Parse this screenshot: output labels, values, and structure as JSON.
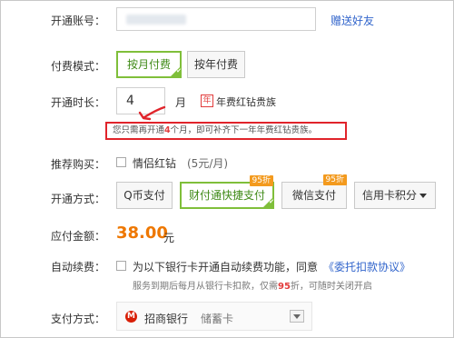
{
  "form": {
    "account": {
      "label": "开通账号：",
      "gift_link": "赠送好友"
    },
    "mode": {
      "label": "付费模式：",
      "options": [
        "按月付费",
        "按年付费"
      ],
      "selected": "按月付费"
    },
    "duration": {
      "label": "开通时长：",
      "value": "4",
      "unit": "月",
      "year_badge": "年",
      "year_text": "年费红钻贵族"
    },
    "notice": {
      "prefix": "您只需再开通",
      "count": "4",
      "suffix": "个月，即可补齐下一年年费红钻贵族。"
    },
    "recommend": {
      "label": "推荐购买：",
      "item": "情侣红钻",
      "price": "(5元/月)"
    },
    "payment": {
      "label": "开通方式：",
      "methods": [
        {
          "name": "Q币支付",
          "tag": ""
        },
        {
          "name": "财付通快捷支付",
          "tag": "95折"
        },
        {
          "name": "微信支付",
          "tag": "95折"
        },
        {
          "name": "信用卡积分",
          "tag": ""
        }
      ],
      "selected": "财付通快捷支付"
    },
    "amount": {
      "label": "应付金额：",
      "value": "38.00",
      "unit": "元"
    },
    "auto_renew": {
      "label": "自动续费：",
      "text": "为以下银行卡开通自动续费功能，同意",
      "agreement": "《委托扣款协议》",
      "note_prefix": "服务到期后每月从银行卡扣款，仅需",
      "note_discount": "95",
      "note_suffix": "折，可随时关闭开启"
    },
    "pay_method": {
      "label": "支付方式：",
      "bank": "招商银行",
      "card_type": "储蓄卡"
    }
  },
  "colors": {
    "selected_green": "#7fbf3a",
    "price_orange": "#ee7700",
    "highlight_red": "#e23c3c",
    "link_blue": "#3366cc",
    "tag_orange": "#f39a1e"
  }
}
